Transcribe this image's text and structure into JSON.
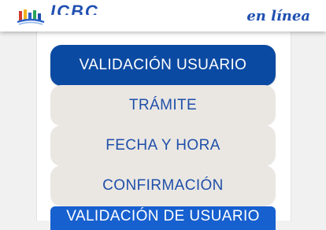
{
  "header": {
    "logo_text": "ICBC",
    "tagline": "en línea"
  },
  "steps": [
    {
      "label": "VALIDACIÓN USUARIO",
      "active": true
    },
    {
      "label": "TRÁMITE",
      "active": false
    },
    {
      "label": "FECHA Y HORA",
      "active": false
    },
    {
      "label": "CONFIRMACIÓN",
      "active": false
    }
  ],
  "section": {
    "title": "VALIDACIÓN DE USUARIO"
  },
  "colors": {
    "brand_blue": "#1f4fb0",
    "active_step": "#0b4aa2",
    "idle_step": "#eae7e3",
    "section_bar": "#1760cf"
  }
}
